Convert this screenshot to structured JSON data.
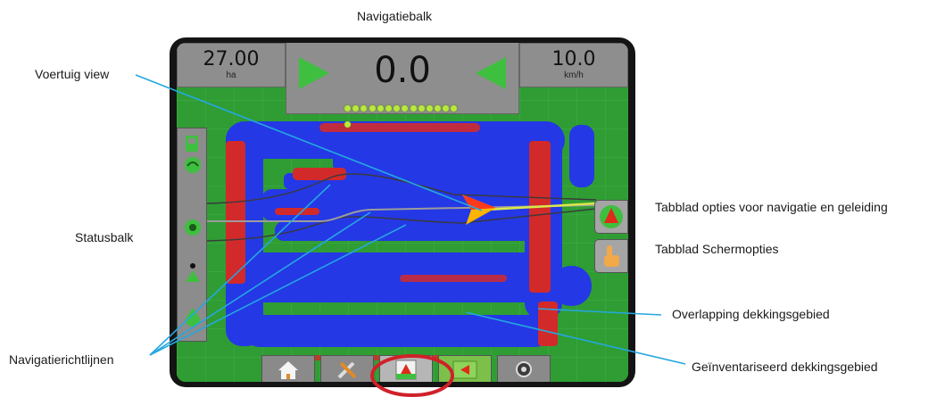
{
  "callouts": {
    "navigatiebalk": "Navigatiebalk",
    "voertuig_view": "Voertuig view",
    "statusbalk": "Statusbalk",
    "navigatierichtlijnen": "Navigatierichtlijnen",
    "tab_navigatie": "Tabblad opties voor navigatie en geleiding",
    "tab_schermopties": "Tabblad Schermopties",
    "overlapping": "Overlapping dekkingsgebied",
    "geinventariseerd": "Geïnventariseerd dekkingsgebied"
  },
  "navbar": {
    "area_value": "27.00",
    "area_unit": "ha",
    "cross_track": "0.0",
    "speed_value": "10.0",
    "speed_unit": "km/h",
    "lightbar_leds": 15
  },
  "colors": {
    "field": "#2f9d34",
    "applied": "#2438e6",
    "overlap": "#d22a2a",
    "leader": "#25a7e0",
    "highlight_circle": "#d0212a"
  },
  "statusbar": {
    "icons": [
      "tractor-icon",
      "gps-status-icon",
      "boom-status-icon",
      "flow-status-icon",
      "tank-icon"
    ]
  },
  "right_tabs": [
    "guidance-options-icon",
    "screen-options-hand-icon"
  ],
  "bottom_tabs": [
    "home-icon",
    "tools-icon",
    "vehicle-view-icon",
    "navigation-view-icon",
    "camera-icon"
  ]
}
